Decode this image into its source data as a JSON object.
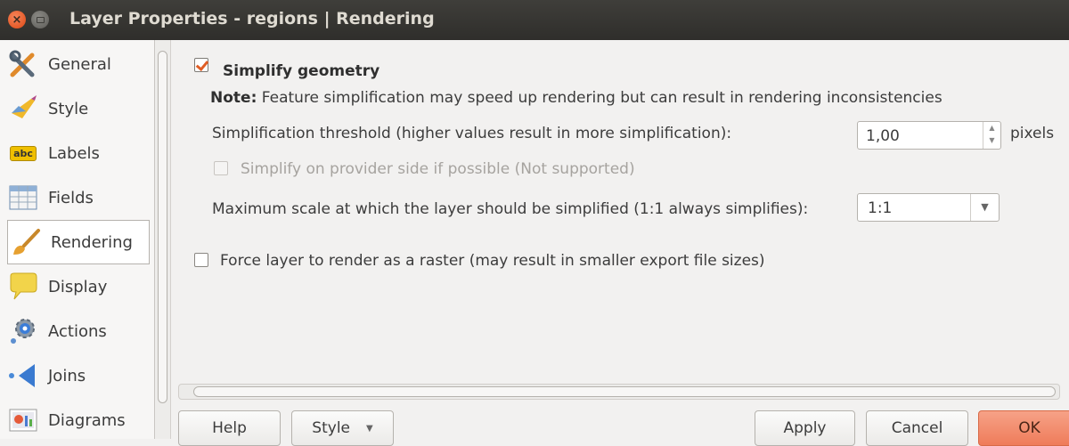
{
  "window": {
    "title": "Layer Properties - regions | Rendering",
    "close_glyph": "×"
  },
  "sidebar": {
    "items": [
      {
        "label": "General",
        "icon": "tools-icon"
      },
      {
        "label": "Style",
        "icon": "brush-icon"
      },
      {
        "label": "Labels",
        "icon": "abc-label-icon",
        "icon_text": "abc"
      },
      {
        "label": "Fields",
        "icon": "table-icon"
      },
      {
        "label": "Rendering",
        "icon": "paintbrush-icon",
        "active": true
      },
      {
        "label": "Display",
        "icon": "speech-bubble-icon"
      },
      {
        "label": "Actions",
        "icon": "gear-icon"
      },
      {
        "label": "Joins",
        "icon": "join-arrow-icon"
      },
      {
        "label": "Diagrams",
        "icon": "diagram-icon"
      }
    ]
  },
  "rendering": {
    "simplify": {
      "label": "Simplify geometry",
      "checked": true,
      "note_prefix": "Note:",
      "note_text": " Feature simplification may speed up rendering but can result in rendering inconsistencies",
      "threshold_label": "Simplification threshold (higher values result in more simplification):",
      "threshold_value": "1,00",
      "threshold_unit": "pixels",
      "provider_side_label": "Simplify on provider side if possible (Not supported)",
      "provider_side_checked": false,
      "max_scale_label": "Maximum scale at which the layer should be simplified (1:1 always simplifies):",
      "max_scale_value": "1:1"
    },
    "force_raster": {
      "label": "Force layer to render as a raster (may result in smaller export file sizes)",
      "checked": false
    }
  },
  "buttons": {
    "help": "Help",
    "style": "Style",
    "apply": "Apply",
    "cancel": "Cancel",
    "ok": "OK"
  },
  "colors": {
    "accent": "#e05e26",
    "titlebar": "#3f3e3a",
    "ok_button": "#f08c6a"
  }
}
